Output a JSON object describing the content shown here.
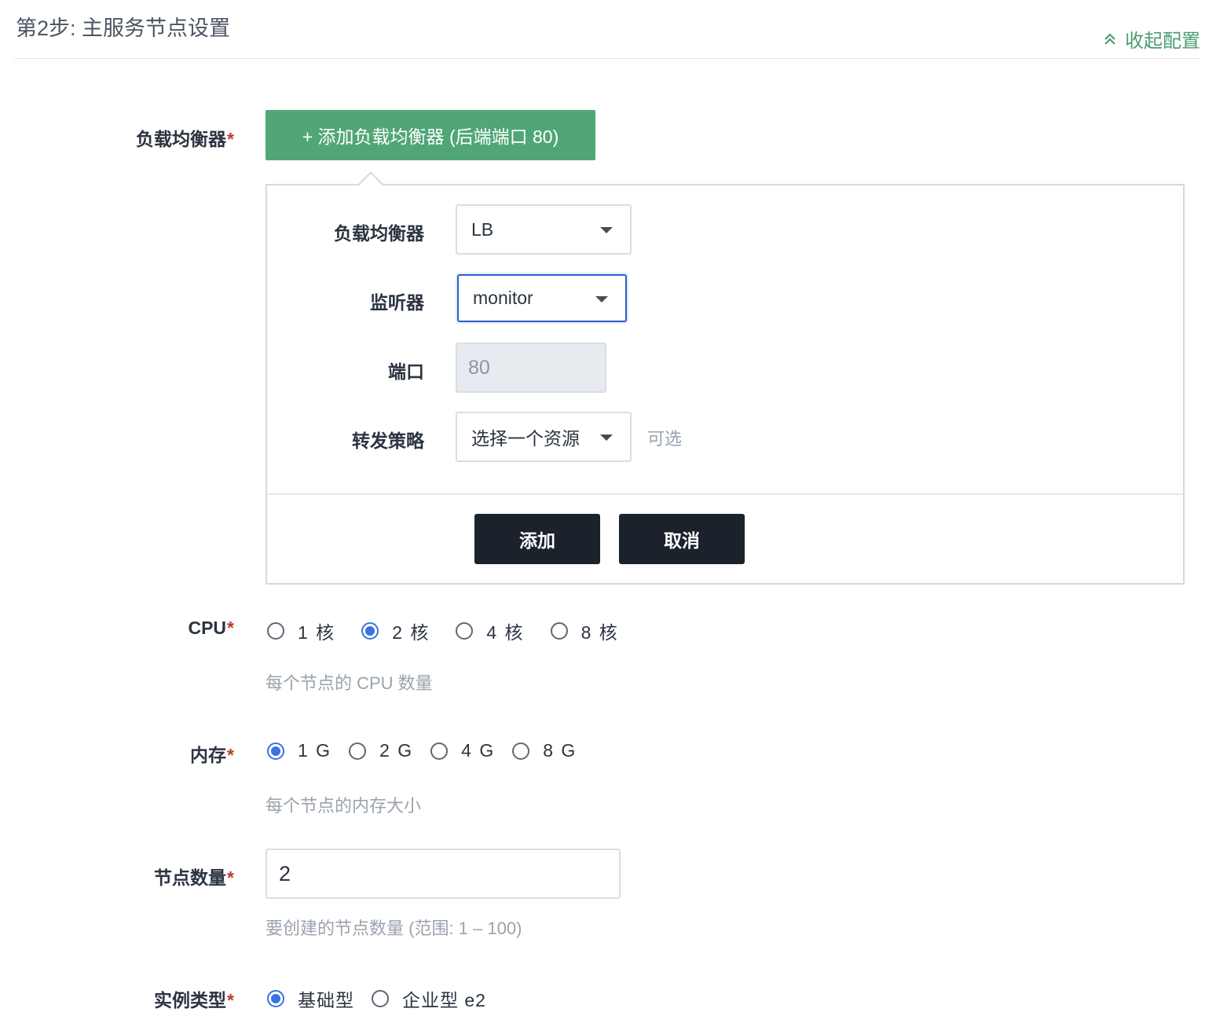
{
  "header": {
    "step_title": "第2步: 主服务节点设置",
    "collapse_label": "收起配置"
  },
  "load_balancer": {
    "label": "负载均衡器",
    "add_button": "+ 添加负载均衡器 (后端端口 80)",
    "panel": {
      "lb_label": "负载均衡器",
      "lb_value": "LB",
      "listener_label": "监听器",
      "listener_value": "monitor",
      "port_label": "端口",
      "port_value": "80",
      "policy_label": "转发策略",
      "policy_value": "选择一个资源",
      "policy_hint": "可选",
      "add_button": "添加",
      "cancel_button": "取消"
    }
  },
  "cpu": {
    "label": "CPU",
    "options": [
      "1 核",
      "2 核",
      "4 核",
      "8 核"
    ],
    "selected_index": 1,
    "hint": "每个节点的 CPU 数量"
  },
  "memory": {
    "label": "内存",
    "options": [
      "1 G",
      "2 G",
      "4 G",
      "8 G"
    ],
    "selected_index": 0,
    "hint": "每个节点的内存大小"
  },
  "node_count": {
    "label": "节点数量",
    "value": "2",
    "hint": "要创建的节点数量 (范围: 1 – 100)"
  },
  "instance_type": {
    "label": "实例类型",
    "options": [
      "基础型",
      "企业型 e2"
    ],
    "selected_index": 0
  },
  "required_mark": "*",
  "colors": {
    "accent_green": "#51a677",
    "link_green": "#4c9e72",
    "radio_blue": "#3a72e0",
    "dark_button": "#1b222b",
    "required_red": "#c0392b"
  },
  "icons": {
    "collapse": "double-chevron-up-icon",
    "dropdown": "caret-down-icon"
  }
}
